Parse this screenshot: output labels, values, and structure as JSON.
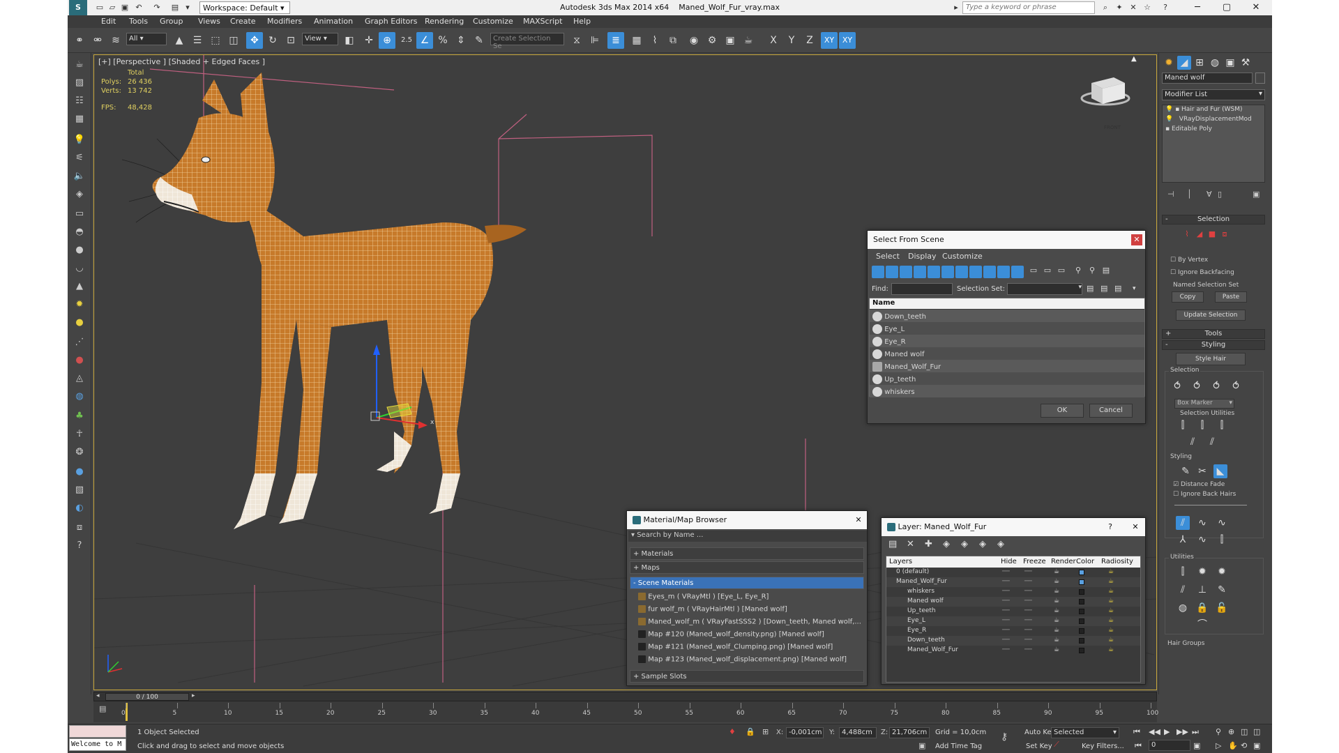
{
  "app": {
    "title": "Autodesk 3ds Max  2014 x64",
    "filename": "Maned_Wolf_Fur_vray.max",
    "workspace": "Workspace: Default",
    "search_placeholder": "Type a keyword or phrase"
  },
  "menu": [
    "Edit",
    "Tools",
    "Group",
    "Views",
    "Create",
    "Modifiers",
    "Animation",
    "Graph Editors",
    "Rendering",
    "Customize",
    "MAXScript",
    "Help"
  ],
  "toolbar": {
    "selection_filter": "All",
    "ref_coord": "View",
    "selection_set_placeholder": "Create Selection Se",
    "axis_x": "X",
    "axis_y": "Y",
    "axis_z": "Z",
    "axis_xy": "XY",
    "axis_xy2": "XY",
    "snap_label": "2.5"
  },
  "viewport": {
    "label": "[+] [Perspective ] [Shaded + Edged Faces ]",
    "stats_total": "Total",
    "polys_label": "Polys:",
    "polys_value": "26 436",
    "verts_label": "Verts:",
    "verts_value": "13 742",
    "fps_label": "FPS:",
    "fps_value": "48,428",
    "cube_label": "FRONT",
    "gizmo_x": "x"
  },
  "select_from_scene": {
    "title": "Select From Scene",
    "menu": [
      "Select",
      "Display",
      "Customize"
    ],
    "find_label": "Find:",
    "selection_set_label": "Selection Set:",
    "column_name": "Name",
    "items": [
      "Down_teeth",
      "Eye_L",
      "Eye_R",
      "Maned wolf",
      "Maned_Wolf_Fur",
      "Up_teeth",
      "whiskers"
    ],
    "ok": "OK",
    "cancel": "Cancel"
  },
  "material_browser": {
    "title": "Material/Map Browser",
    "search_placeholder": "Search by Name ...",
    "sections": [
      "+ Materials",
      "+ Maps",
      "- Scene Materials"
    ],
    "items": [
      "Eyes_m  ( VRayMtl )  [Eye_L, Eye_R]",
      "fur wolf_m  ( VRayHairMtl )  [Maned wolf]",
      "Maned_wolf_m  ( VRayFastSSS2 )  [Down_teeth, Maned wolf,...",
      "Map #120 (Maned_wolf_density.png) [Maned wolf]",
      "Map #121 (Maned_wolf_Clumping.png) [Maned wolf]",
      "Map #123 (Maned_wolf_displacement.png) [Maned wolf]"
    ],
    "sample_slots": "+ Sample Slots"
  },
  "layer_dialog": {
    "title": "Layer: Maned_Wolf_Fur",
    "help": "?",
    "columns": [
      "Layers",
      "Hide",
      "Freeze",
      "Render",
      "Color",
      "Radiosity"
    ],
    "rows": [
      "0 (default)",
      "Maned_Wolf_Fur",
      "whiskers",
      "Maned wolf",
      "Up_teeth",
      "Eye_L",
      "Eye_R",
      "Down_teeth",
      "Maned_Wolf_Fur"
    ]
  },
  "command_panel": {
    "object_name": "Maned wolf",
    "modifier_list": "Modifier List",
    "stack": [
      "Hair and Fur (WSM)",
      "VRayDisplacementMod",
      "Editable Poly"
    ],
    "selection_header": "Selection",
    "by_vertex": "By Vertex",
    "ignore_backfacing": "Ignore Backfacing",
    "named_selection_set": "Named Selection Set",
    "copy": "Copy",
    "paste": "Paste",
    "update_selection": "Update Selection",
    "tools_header": "Tools",
    "styling_header": "Styling",
    "style_hair": "Style Hair",
    "selection_sub": "Selection",
    "box_marker": "Box Marker",
    "selection_utilities": "Selection Utilities",
    "styling_sub": "Styling",
    "distance_fade": "Distance Fade",
    "ignore_back_hairs": "Ignore Back Hairs",
    "utilities_sub": "Utilities",
    "hair_groups": "Hair Groups",
    "plus": "+",
    "minus": "-"
  },
  "timeline": {
    "frame": "0 / 100",
    "ticks": [
      0,
      5,
      10,
      15,
      20,
      25,
      30,
      35,
      40,
      45,
      50,
      55,
      60,
      65,
      70,
      75,
      80,
      85,
      90,
      95,
      100
    ]
  },
  "status": {
    "welcome": "Welcome to M",
    "selected": "1 Object Selected",
    "prompt": "Click and drag to select and move objects",
    "x_label": "X:",
    "x_value": "-0,001cm",
    "y_label": "Y:",
    "y_value": "4,488cm",
    "z_label": "Z:",
    "z_value": "21,706cm",
    "grid": "Grid = 10,0cm",
    "add_time_tag": "Add Time Tag",
    "auto_key": "Auto Key",
    "set_key": "Set Key",
    "selected_dd": "Selected",
    "key_filters": "Key Filters...",
    "frame_value": "0"
  },
  "colors": {
    "accent": "#3b8ed8",
    "viewport_border": "#c9a83c",
    "fur": "#c77a2a",
    "stats": "#e0d060"
  }
}
